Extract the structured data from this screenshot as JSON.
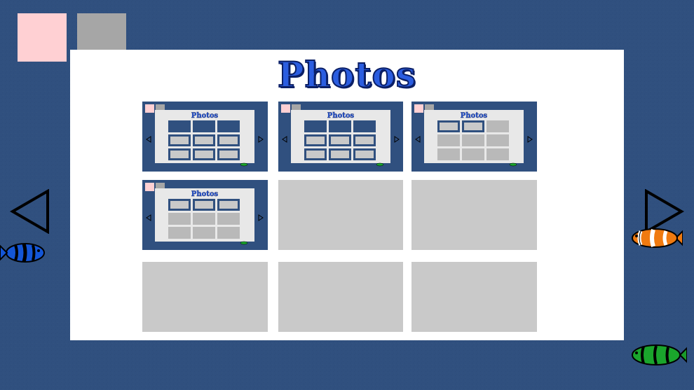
{
  "app": {
    "title": "Photos"
  },
  "colors": {
    "background": "#30507f",
    "panel": "#ffffff",
    "title": "#2b5de0",
    "title_outline": "#0b1f66",
    "empty_slot": "#c9c9c9",
    "pink_square": "#ffd0d3",
    "gray_square": "#a6a6a6"
  },
  "top_squares": [
    {
      "name": "pink-square",
      "color": "#ffd0d3"
    },
    {
      "name": "gray-square",
      "color": "#a6a6a6"
    }
  ],
  "grid": {
    "rows": 3,
    "cols": 3,
    "slots": [
      {
        "filled": true,
        "mini_title": "Photos"
      },
      {
        "filled": true,
        "mini_title": "Photos"
      },
      {
        "filled": true,
        "mini_title": "Photos"
      },
      {
        "filled": true,
        "mini_title": "Photos"
      },
      {
        "filled": false
      },
      {
        "filled": false
      },
      {
        "filled": false
      },
      {
        "filled": false
      },
      {
        "filled": false
      }
    ]
  },
  "navigation": {
    "prev_icon": "triangle-left-outline",
    "next_icon": "triangle-right-outline"
  },
  "decorations": {
    "fish": [
      "blue-striped-fish",
      "orange-clownfish",
      "green-striped-fish"
    ]
  }
}
